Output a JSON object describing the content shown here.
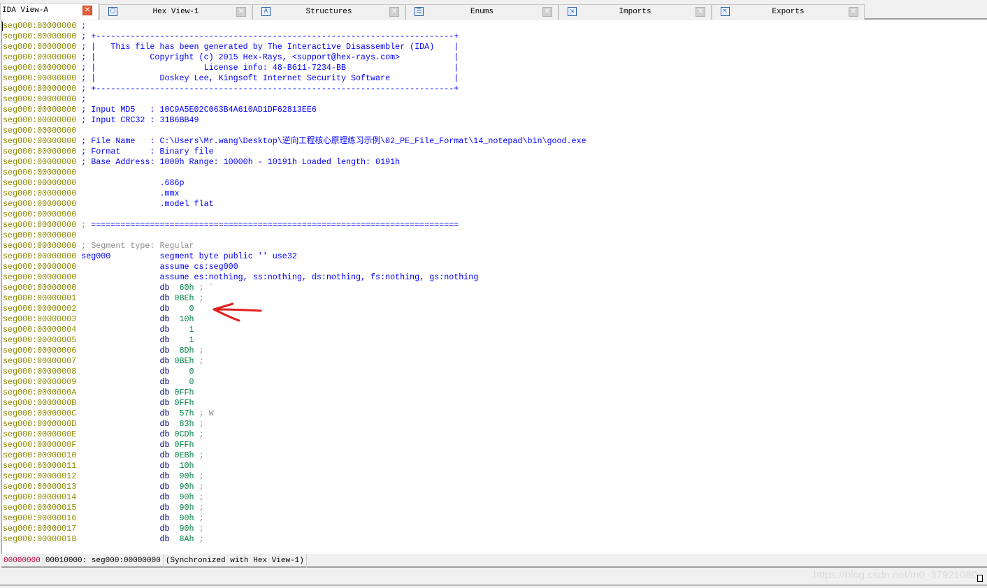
{
  "tabs": [
    {
      "label": "IDA View-A",
      "icon": "ida-view-icon",
      "active": true
    },
    {
      "label": "Hex View-1",
      "icon": "hex-view-icon",
      "active": false
    },
    {
      "label": "Structures",
      "icon": "structures-icon",
      "active": false
    },
    {
      "label": "Enums",
      "icon": "enums-icon",
      "active": false
    },
    {
      "label": "Imports",
      "icon": "imports-icon",
      "active": false
    },
    {
      "label": "Exports",
      "icon": "exports-icon",
      "active": false
    }
  ],
  "lines": [
    {
      "addr": "seg000:00000000",
      "parts": [
        [
          "c",
          " ;"
        ]
      ]
    },
    {
      "addr": "seg000:00000000",
      "parts": [
        [
          "c",
          " ; +-------------------------------------------------------------------------+"
        ]
      ]
    },
    {
      "addr": "seg000:00000000",
      "parts": [
        [
          "c",
          " ; |   This file has been generated by The Interactive Disassembler (IDA)    |"
        ]
      ]
    },
    {
      "addr": "seg000:00000000",
      "parts": [
        [
          "c",
          " ; |           Copyright (c) 2015 Hex-Rays, <support@hex-rays.com>           |"
        ]
      ]
    },
    {
      "addr": "seg000:00000000",
      "parts": [
        [
          "c",
          " ; |                      License info: 48-B611-7234-BB                      |"
        ]
      ]
    },
    {
      "addr": "seg000:00000000",
      "parts": [
        [
          "c",
          " ; |             Doskey Lee, Kingsoft Internet Security Software             |"
        ]
      ]
    },
    {
      "addr": "seg000:00000000",
      "parts": [
        [
          "c",
          " ; +-------------------------------------------------------------------------+"
        ]
      ]
    },
    {
      "addr": "seg000:00000000",
      "parts": [
        [
          "c",
          " ;"
        ]
      ]
    },
    {
      "addr": "seg000:00000000",
      "parts": [
        [
          "c",
          " ; Input MD5   : 10C9A5E02C063B4A610AD1DF62813EE6"
        ]
      ]
    },
    {
      "addr": "seg000:00000000",
      "parts": [
        [
          "c",
          " ; Input CRC32 : 31B6BB49"
        ]
      ]
    },
    {
      "addr": "seg000:00000000",
      "parts": []
    },
    {
      "addr": "seg000:00000000",
      "parts": [
        [
          "c",
          " ; File Name   : C:\\Users\\Mr.wang\\Desktop\\逆向工程核心原理练习示例\\02_PE_File_Format\\14_notepad\\bin\\good.exe"
        ]
      ]
    },
    {
      "addr": "seg000:00000000",
      "parts": [
        [
          "c",
          " ; Format      : Binary file"
        ]
      ]
    },
    {
      "addr": "seg000:00000000",
      "parts": [
        [
          "c",
          " ; Base Address: 1000h Range: 10000h - 10191h Loaded length: 0191h"
        ]
      ]
    },
    {
      "addr": "seg000:00000000",
      "parts": []
    },
    {
      "addr": "seg000:00000000",
      "parts": [
        [
          "c",
          "                 .686p"
        ]
      ]
    },
    {
      "addr": "seg000:00000000",
      "parts": [
        [
          "c",
          "                 .mmx"
        ]
      ]
    },
    {
      "addr": "seg000:00000000",
      "parts": [
        [
          "c",
          "                 .model flat"
        ]
      ]
    },
    {
      "addr": "seg000:00000000",
      "parts": []
    },
    {
      "addr": "seg000:00000000",
      "parts": [
        [
          "g",
          " ; "
        ],
        [
          "c",
          "==========================================================================="
        ]
      ]
    },
    {
      "addr": "seg000:00000000",
      "parts": []
    },
    {
      "addr": "seg000:00000000",
      "parts": [
        [
          "g",
          " ; Segment type: Regular"
        ]
      ]
    },
    {
      "addr": "seg000:00000000",
      "parts": [
        [
          "l",
          " seg000"
        ],
        [
          "c",
          "          segment byte public '' use32"
        ]
      ]
    },
    {
      "addr": "seg000:00000000",
      "parts": [
        [
          "c",
          "                 assume cs:seg000"
        ]
      ]
    },
    {
      "addr": "seg000:00000000",
      "parts": [
        [
          "c",
          "                 assume es:nothing, ss:nothing, ds:nothing, fs:nothing, gs:nothing"
        ]
      ]
    },
    {
      "addr": "seg000:00000000",
      "parts": [
        [
          "k",
          "                 db"
        ],
        [
          "n",
          "  60h"
        ],
        [
          "g",
          " ; `"
        ]
      ]
    },
    {
      "addr": "seg000:00000001",
      "parts": [
        [
          "k",
          "                 db"
        ],
        [
          "n",
          " 0BEh"
        ],
        [
          "g",
          " ;"
        ]
      ]
    },
    {
      "addr": "seg000:00000002",
      "parts": [
        [
          "k",
          "                 db"
        ],
        [
          "n",
          "    0"
        ]
      ]
    },
    {
      "addr": "seg000:00000003",
      "parts": [
        [
          "k",
          "                 db"
        ],
        [
          "n",
          "  10h"
        ]
      ]
    },
    {
      "addr": "seg000:00000004",
      "parts": [
        [
          "k",
          "                 db"
        ],
        [
          "n",
          "    1"
        ]
      ]
    },
    {
      "addr": "seg000:00000005",
      "parts": [
        [
          "k",
          "                 db"
        ],
        [
          "n",
          "    1"
        ]
      ]
    },
    {
      "addr": "seg000:00000006",
      "parts": [
        [
          "k",
          "                 db"
        ],
        [
          "n",
          "  8Dh"
        ],
        [
          "g",
          " ;"
        ]
      ]
    },
    {
      "addr": "seg000:00000007",
      "parts": [
        [
          "k",
          "                 db"
        ],
        [
          "n",
          " 0BEh"
        ],
        [
          "g",
          " ;"
        ]
      ]
    },
    {
      "addr": "seg000:00000008",
      "parts": [
        [
          "k",
          "                 db"
        ],
        [
          "n",
          "    0"
        ]
      ]
    },
    {
      "addr": "seg000:00000009",
      "parts": [
        [
          "k",
          "                 db"
        ],
        [
          "n",
          "    0"
        ]
      ]
    },
    {
      "addr": "seg000:0000000A",
      "parts": [
        [
          "k",
          "                 db"
        ],
        [
          "n",
          " 0FFh"
        ]
      ]
    },
    {
      "addr": "seg000:0000000B",
      "parts": [
        [
          "k",
          "                 db"
        ],
        [
          "n",
          " 0FFh"
        ]
      ]
    },
    {
      "addr": "seg000:0000000C",
      "parts": [
        [
          "k",
          "                 db"
        ],
        [
          "n",
          "  57h"
        ],
        [
          "g",
          " ; W"
        ]
      ]
    },
    {
      "addr": "seg000:0000000D",
      "parts": [
        [
          "k",
          "                 db"
        ],
        [
          "n",
          "  83h"
        ],
        [
          "g",
          " ;"
        ]
      ]
    },
    {
      "addr": "seg000:0000000E",
      "parts": [
        [
          "k",
          "                 db"
        ],
        [
          "n",
          " 0CDh"
        ],
        [
          "g",
          " ;"
        ]
      ]
    },
    {
      "addr": "seg000:0000000F",
      "parts": [
        [
          "k",
          "                 db"
        ],
        [
          "n",
          " 0FFh"
        ]
      ]
    },
    {
      "addr": "seg000:00000010",
      "parts": [
        [
          "k",
          "                 db"
        ],
        [
          "n",
          " 0EBh"
        ],
        [
          "g",
          " ;"
        ]
      ]
    },
    {
      "addr": "seg000:00000011",
      "parts": [
        [
          "k",
          "                 db"
        ],
        [
          "n",
          "  10h"
        ]
      ]
    },
    {
      "addr": "seg000:00000012",
      "parts": [
        [
          "k",
          "                 db"
        ],
        [
          "n",
          "  90h"
        ],
        [
          "g",
          " ;"
        ]
      ]
    },
    {
      "addr": "seg000:00000013",
      "parts": [
        [
          "k",
          "                 db"
        ],
        [
          "n",
          "  90h"
        ],
        [
          "g",
          " ;"
        ]
      ]
    },
    {
      "addr": "seg000:00000014",
      "parts": [
        [
          "k",
          "                 db"
        ],
        [
          "n",
          "  90h"
        ],
        [
          "g",
          " ;"
        ]
      ]
    },
    {
      "addr": "seg000:00000015",
      "parts": [
        [
          "k",
          "                 db"
        ],
        [
          "n",
          "  90h"
        ],
        [
          "g",
          " ;"
        ]
      ]
    },
    {
      "addr": "seg000:00000016",
      "parts": [
        [
          "k",
          "                 db"
        ],
        [
          "n",
          "  90h"
        ],
        [
          "g",
          " ;"
        ]
      ]
    },
    {
      "addr": "seg000:00000017",
      "parts": [
        [
          "k",
          "                 db"
        ],
        [
          "n",
          "  90h"
        ],
        [
          "g",
          " ;"
        ]
      ]
    },
    {
      "addr": "seg000:00000018",
      "parts": [
        [
          "k",
          "                 db"
        ],
        [
          "n",
          "  8Ah"
        ],
        [
          "g",
          " ;"
        ]
      ]
    }
  ],
  "status": {
    "offset": "00000000",
    "location": "00010000: seg000:00000000",
    "sync": "(Synchronized with Hex View-1)"
  },
  "watermark": "https://blog.csdn.net/m0_37921080",
  "colors": {
    "address": "#8a8a00",
    "code": "#0000ff",
    "mnemonic": "#000080",
    "number": "#008040",
    "comment": "#8c8c8c",
    "annotation_arrow": "#e02020"
  }
}
